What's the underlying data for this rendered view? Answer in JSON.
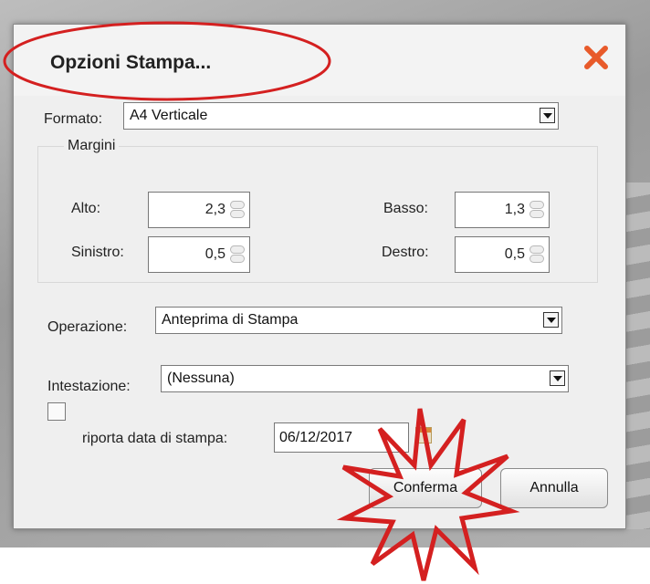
{
  "dialog": {
    "title": "Opzioni Stampa...",
    "close_icon": "close-icon"
  },
  "formato": {
    "label": "Formato:",
    "value": "A4 Verticale"
  },
  "margini": {
    "legend": "Margini",
    "alto": {
      "label": "Alto:",
      "value": "2,3"
    },
    "basso": {
      "label": "Basso:",
      "value": "1,3"
    },
    "sinistro": {
      "label": "Sinistro:",
      "value": "0,5"
    },
    "destro": {
      "label": "Destro:",
      "value": "0,5"
    }
  },
  "operazione": {
    "label": "Operazione:",
    "value": "Anteprima di Stampa"
  },
  "intestazione": {
    "label": "Intestazione:",
    "value": "(Nessuna)"
  },
  "data_stampa": {
    "label": "riporta data di stampa:",
    "checked": false,
    "value": "06/12/2017",
    "icon": "calendar-icon"
  },
  "buttons": {
    "confirm": "Conferma",
    "cancel": "Annulla"
  },
  "annotations": {
    "highlight_color": "#d42020"
  }
}
